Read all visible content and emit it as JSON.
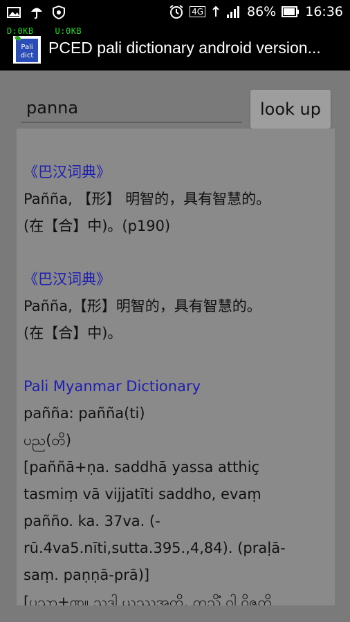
{
  "status_bar": {
    "battery": "86%",
    "time": "16:36",
    "network": "4G"
  },
  "net_speed": {
    "download": "D:0KB",
    "upload": "U:0KB"
  },
  "app_bar": {
    "title": "PCED pali dictionary android version...",
    "icon_text_top": "Pali",
    "icon_text_bottom": "dict"
  },
  "search": {
    "value": "panna",
    "button_label": "look up"
  },
  "results": [
    {
      "source": "《巴汉词典》",
      "lines": [
        "Pañña, 【形】 明智的，具有智慧的。",
        "(在【合】中)。(p190)"
      ]
    },
    {
      "source": "《巴汉词典》",
      "lines": [
        "Pañña,【形】明智的，具有智慧的。",
        "(在【合】中)。"
      ]
    },
    {
      "source": "Pali Myanmar Dictionary",
      "lines": [
        "pañña: pañña(ti)",
        "ပည(တိ)",
        "[paññā+ṇa. saddhā yassa atthiç",
        "tasmiṃ vā vijjatīti saddho, evaṃ",
        "pañño. ka. 37va. (-",
        "rū.4va5.nīti,sutta.395.,4,84). (praḷā-",
        "saṃ. paṇṇā-prā)]",
        "[ပညာ+ဏ။ သဒ္ဓါ ယဿအတ္ထိ, တသ္မိံ ဝါ ဝိဇ္ဇတိ"
      ]
    }
  ],
  "colors": {
    "background": "#7a7a7a",
    "panel": "#8a8a8a",
    "link_blue": "#1f1fb0",
    "net_speed_green": "#22d822"
  }
}
